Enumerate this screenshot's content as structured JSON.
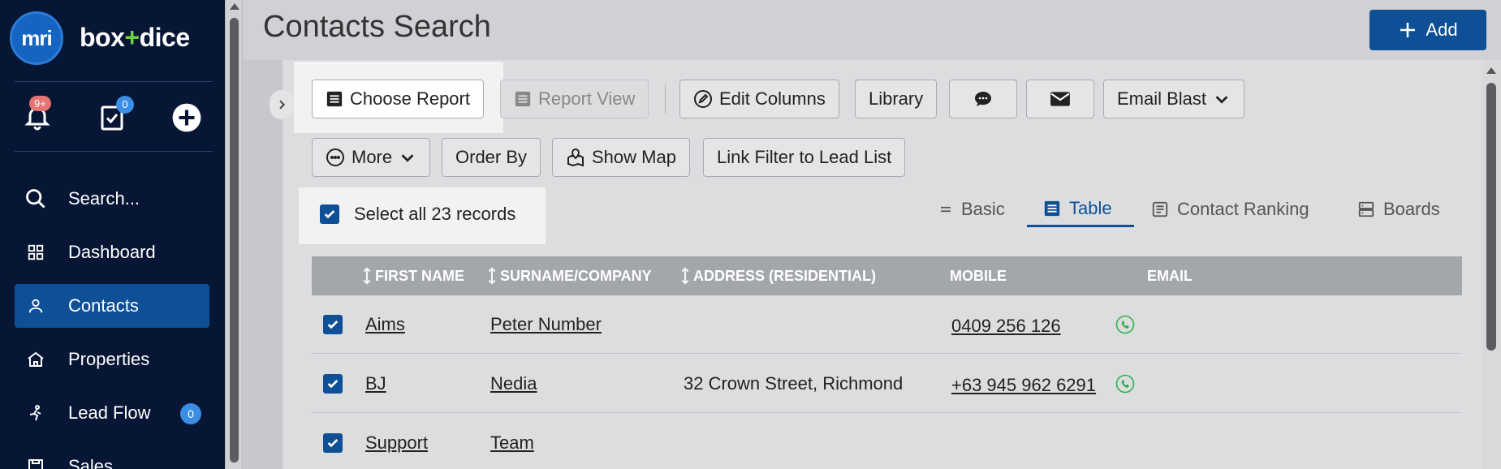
{
  "sidebar": {
    "logo_mark": "mri",
    "brand_left": "box",
    "brand_plus": "+",
    "brand_right": "dice",
    "notifications_badge": "9+",
    "tasks_badge": "0",
    "items": [
      {
        "label": "Search...",
        "icon": "search-icon"
      },
      {
        "label": "Dashboard",
        "icon": "grid-icon"
      },
      {
        "label": "Contacts",
        "icon": "person-icon",
        "active": true
      },
      {
        "label": "Properties",
        "icon": "house-icon"
      },
      {
        "label": "Lead Flow",
        "icon": "lead-flow-icon",
        "count": "0"
      },
      {
        "label": "Sales",
        "icon": "sales-icon"
      }
    ]
  },
  "header": {
    "title": "Contacts Search",
    "add_label": "Add"
  },
  "toolbar": {
    "choose_report": "Choose Report",
    "report_view": "Report View",
    "edit_columns": "Edit Columns",
    "library": "Library",
    "email_blast": "Email Blast",
    "more": "More",
    "order_by": "Order By",
    "show_map": "Show Map",
    "link_filter": "Link Filter to Lead List"
  },
  "select_all": "Select all 23 records",
  "view_tabs": [
    {
      "label": "Basic"
    },
    {
      "label": "Table",
      "active": true
    },
    {
      "label": "Contact Ranking"
    },
    {
      "label": "Boards"
    }
  ],
  "table": {
    "columns": [
      "FIRST NAME",
      "SURNAME/COMPANY",
      "ADDRESS (RESIDENTIAL)",
      "MOBILE",
      "EMAIL"
    ],
    "rows": [
      {
        "first": "Aims",
        "surname": "Peter Number",
        "address": "",
        "mobile": "0409 256 126"
      },
      {
        "first": "BJ",
        "surname": "Nedia",
        "address": "32 Crown Street, Richmond",
        "mobile": "+63 945 962 6291"
      },
      {
        "first": "Support",
        "surname": "Team",
        "address": "",
        "mobile": ""
      }
    ]
  },
  "colors": {
    "accent": "#0f4f96",
    "sidebar_bg": "#071634",
    "phone_green": "#2fb14a"
  }
}
